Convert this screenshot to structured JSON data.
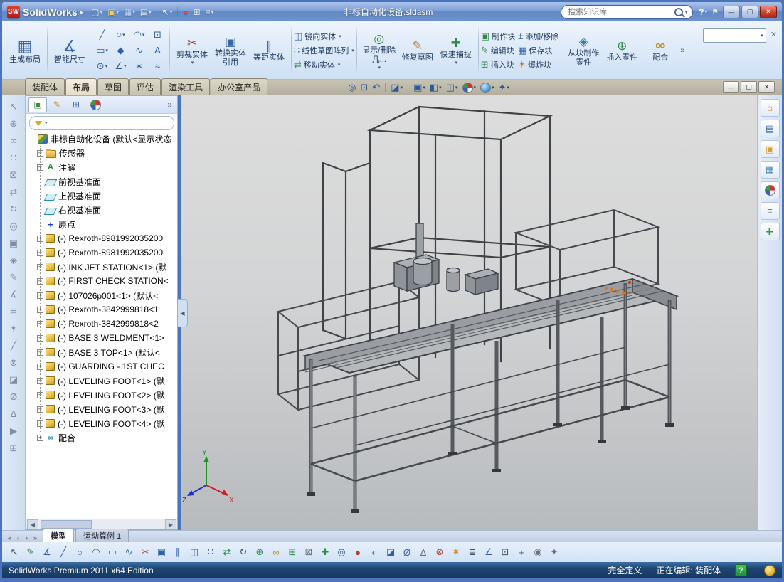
{
  "ui": {
    "dropdown_glyph": "▾",
    "overflow_glyph": "»"
  },
  "titlebar": {
    "app_name": "SolidWorks",
    "logo_text": "SW",
    "menu_arrow": "▸",
    "doc_title": "非标自动化设备.sldasm",
    "search_placeholder": "搜索知识库",
    "help_glyph": "?",
    "pin_glyph": "⚑",
    "qat": [
      {
        "name": "new-document",
        "g": "▢",
        "c": "#f0f4fc",
        "arrow": true
      },
      {
        "name": "open-document",
        "g": "▣",
        "c": "#f0cc6a",
        "arrow": true
      },
      {
        "name": "save-document",
        "g": "▦",
        "c": "#bcd2f2",
        "arrow": true
      },
      {
        "name": "print-document",
        "g": "▤",
        "c": "#e0e8f2",
        "arrow": true
      },
      {
        "sep": true
      },
      {
        "name": "select-cursor",
        "g": "↖",
        "c": "#ffffff",
        "arrow": true
      },
      {
        "sep": true
      },
      {
        "name": "rebuild",
        "g": "●",
        "c": "#e04838"
      },
      {
        "name": "file-properties",
        "g": "⊞",
        "c": "#dfe7f2"
      },
      {
        "name": "options",
        "g": "≡",
        "c": "#f0f4fc",
        "arrow": true
      }
    ],
    "window_controls": [
      {
        "name": "window-minimize",
        "g": "—"
      },
      {
        "name": "window-maximize",
        "g": "▢"
      },
      {
        "name": "window-close",
        "g": "✕"
      }
    ]
  },
  "ribbon": {
    "groups": {
      "layout": {
        "label": "生成布局",
        "glyph": "▦"
      },
      "smart_dimension": {
        "label": "智能尺寸",
        "glyph": "∡"
      },
      "trim": {
        "label": "剪裁实体",
        "glyph": "✂"
      },
      "convert": {
        "label": "转换实体引用",
        "glyph": "▣"
      },
      "offset": {
        "label": "等距实体",
        "glyph": "∥"
      },
      "mirror": {
        "label": "镜向实体",
        "glyph": "◫"
      },
      "linear_pattern": {
        "label": "线性草图阵列",
        "glyph": "∷"
      },
      "move": {
        "label": "移动实体",
        "glyph": "⇄"
      },
      "display_delete": {
        "label": "显示/删除几...",
        "glyph": "◎"
      },
      "repair": {
        "label": "修复草图",
        "glyph": "✎"
      },
      "quick_snap": {
        "label": "快速捕捉",
        "glyph": "✚"
      },
      "make_block": {
        "label": "制作块",
        "glyph": "▣"
      },
      "edit_block": {
        "label": "编辑块",
        "glyph": "✎"
      },
      "insert_block": {
        "label": "插入块",
        "glyph": "⊞"
      },
      "add_remove": {
        "label": "添加/移除",
        "glyph": "±"
      },
      "save_block": {
        "label": "保存块",
        "glyph": "▦"
      },
      "explode_block": {
        "label": "爆炸块",
        "glyph": "✶"
      },
      "part_from_block": {
        "label": "从块制作零件",
        "glyph": "◈"
      },
      "insert_part": {
        "label": "插入零件",
        "glyph": "⊕"
      },
      "mate": {
        "label": "配合",
        "glyph": "∞"
      }
    },
    "sketch_tools": [
      {
        "name": "sketch-line",
        "g": "╱"
      },
      {
        "name": "sketch-circle",
        "g": "○",
        "arrow": true
      },
      {
        "name": "sketch-arc",
        "g": "◠",
        "arrow": true
      },
      {
        "name": "sketch-select-box",
        "g": "⊡"
      },
      {
        "name": "sketch-rectangle",
        "g": "▭",
        "arrow": true
      },
      {
        "name": "sketch-polygon",
        "g": "◆"
      },
      {
        "name": "sketch-spline",
        "g": "∿"
      },
      {
        "name": "sketch-text",
        "g": "A"
      },
      {
        "name": "sketch-ellipse",
        "g": "⊙",
        "arrow": true
      },
      {
        "name": "sketch-fillet",
        "g": "∠",
        "arrow": true
      },
      {
        "name": "sketch-point",
        "g": "∗"
      },
      {
        "name": "sketch-construction",
        "g": "≈"
      }
    ]
  },
  "tabrow": {
    "tabs": [
      {
        "label": "装配体"
      },
      {
        "label": "布局"
      },
      {
        "label": "草图"
      },
      {
        "label": "评估"
      },
      {
        "label": "渲染工具"
      },
      {
        "label": "办公室产品"
      }
    ],
    "active_tab": "布局",
    "doc_controls": [
      {
        "name": "document-minimize",
        "g": "—"
      },
      {
        "name": "document-restore",
        "g": "▢"
      },
      {
        "name": "document-close",
        "g": "✕"
      }
    ]
  },
  "headsup": {
    "icons": [
      {
        "name": "zoom-fit",
        "g": "◎",
        "c": "#2a5a9a"
      },
      {
        "name": "zoom-area",
        "g": "⊡",
        "c": "#2a5a9a"
      },
      {
        "name": "previous-view",
        "g": "↶",
        "c": "#2a5a9a"
      },
      {
        "sep": true
      },
      {
        "name": "section-view",
        "g": "◪",
        "c": "#2a5a9a",
        "arrow": true
      },
      {
        "sep": true
      },
      {
        "name": "view-orientation",
        "g": "▣",
        "c": "#2a5a9a",
        "arrow": true
      },
      {
        "name": "display-style",
        "g": "◧",
        "c": "#2a5a9a",
        "arrow": true
      },
      {
        "name": "hide-show-items",
        "g": "◫",
        "c": "#2a5a9a",
        "arrow": true
      },
      {
        "name": "edit-appearance",
        "ball": "ball-app",
        "arrow": true
      },
      {
        "name": "apply-scene",
        "ball": "ball-scene",
        "arrow": true
      },
      {
        "name": "view-settings",
        "g": "✦",
        "c": "#2a5a9a",
        "arrow": true
      }
    ]
  },
  "feature_tree": {
    "header_tabs": [
      {
        "name": "featuremanager-tab",
        "g": "▣",
        "c": "#3a8a3a"
      },
      {
        "name": "propertymanager-tab",
        "g": "✎",
        "c": "#c09020"
      },
      {
        "name": "configurationmanager-tab",
        "g": "⊞",
        "c": "#3a6ab0"
      },
      {
        "name": "displaymanager-tab",
        "ball": "ball-app"
      }
    ],
    "flyout_glyph": "»",
    "items": [
      {
        "id": "root",
        "icon": "assembly",
        "label": "非标自动化设备 (默认<显示状态",
        "root": true
      },
      {
        "id": "sensors-folder",
        "icon": "folder",
        "label": "传感器",
        "exp": "+"
      },
      {
        "id": "annotations",
        "icon": "annotation",
        "label": "注解",
        "exp": "+"
      },
      {
        "id": "front-plane",
        "icon": "plane",
        "label": "前视基准面"
      },
      {
        "id": "top-plane",
        "icon": "plane",
        "label": "上视基准面"
      },
      {
        "id": "right-plane",
        "icon": "plane",
        "label": "右视基准面"
      },
      {
        "id": "origin",
        "icon": "origin",
        "label": "原点"
      },
      {
        "id": "comp-rexroth-1",
        "icon": "part",
        "label": "(-) Rexroth-8981992035200",
        "exp": "+"
      },
      {
        "id": "comp-rexroth-2",
        "icon": "part",
        "label": "(-) Rexroth-8981992035200",
        "exp": "+"
      },
      {
        "id": "comp-inkjet",
        "icon": "part",
        "label": "(-) INK JET STATION<1> (默",
        "exp": "+"
      },
      {
        "id": "comp-firstcheck",
        "icon": "part",
        "label": "(-) FIRST CHECK STATION<",
        "exp": "+"
      },
      {
        "id": "comp-107026p001",
        "icon": "part",
        "label": "(-) 107026p001<1> (默认<",
        "exp": "+"
      },
      {
        "id": "comp-rexroth-3842-1",
        "icon": "part",
        "label": "(-) Rexroth-3842999818<1",
        "exp": "+"
      },
      {
        "id": "comp-rexroth-3842-2",
        "icon": "part",
        "label": "(-) Rexroth-3842999818<2",
        "exp": "+"
      },
      {
        "id": "comp-base3-weldment",
        "icon": "part",
        "label": "(-) BASE 3 WELDMENT<1>",
        "exp": "+"
      },
      {
        "id": "comp-base3-top",
        "icon": "part",
        "label": "(-) BASE 3 TOP<1> (默认<",
        "exp": "+"
      },
      {
        "id": "comp-guarding",
        "icon": "part",
        "label": "(-) GUARDING - 1ST CHEC",
        "exp": "+"
      },
      {
        "id": "comp-leveling-foot-1",
        "icon": "part",
        "label": "(-) LEVELING FOOT<1> (默",
        "exp": "+"
      },
      {
        "id": "comp-leveling-foot-2",
        "icon": "part",
        "label": "(-) LEVELING FOOT<2> (默",
        "exp": "+"
      },
      {
        "id": "comp-leveling-foot-3",
        "icon": "part",
        "label": "(-) LEVELING FOOT<3> (默",
        "exp": "+"
      },
      {
        "id": "comp-leveling-foot-4",
        "icon": "part",
        "label": "(-) LEVELING FOOT<4> (默",
        "exp": "+"
      },
      {
        "id": "mates",
        "icon": "mate",
        "label": "配合",
        "exp": "+"
      }
    ]
  },
  "leftbar": {
    "icons": [
      {
        "name": "select-tool",
        "g": "↖",
        "c": "#7d8da3"
      },
      {
        "name": "insert-components",
        "g": "⊕",
        "c": "#7d8da3"
      },
      {
        "name": "mate-tool",
        "g": "∞",
        "c": "#7d8da3"
      },
      {
        "name": "component-pattern",
        "g": "∷",
        "c": "#7d8da3"
      },
      {
        "name": "smart-fasteners",
        "g": "⊠",
        "c": "#7d8da3"
      },
      {
        "name": "move-component",
        "g": "⇄",
        "c": "#7d8da3"
      },
      {
        "name": "rotate-component",
        "g": "↻",
        "c": "#7d8da3"
      },
      {
        "name": "show-hidden-components",
        "g": "◎",
        "c": "#7d8da3"
      },
      {
        "name": "assembly-features",
        "g": "▣",
        "c": "#7d8da3"
      },
      {
        "name": "reference-geometry",
        "g": "◈",
        "c": "#7d8da3"
      },
      {
        "name": "sketch-tool",
        "g": "✎",
        "c": "#7d8da3"
      },
      {
        "name": "smart-dimension-tool",
        "g": "∡",
        "c": "#7d8da3"
      },
      {
        "name": "bill-of-materials",
        "g": "≣",
        "c": "#7d8da3"
      },
      {
        "name": "exploded-view",
        "g": "✶",
        "c": "#7d8da3"
      },
      {
        "name": "explode-line-sketch",
        "g": "╱",
        "c": "#7d8da3"
      },
      {
        "name": "interference-detection",
        "g": "⊗",
        "c": "#7d8da3"
      },
      {
        "name": "aligned-section-view",
        "g": "◪",
        "c": "#7d8da3"
      },
      {
        "name": "measure-tool",
        "g": "Ø",
        "c": "#7d8da3"
      },
      {
        "name": "mass-properties",
        "g": "Δ",
        "c": "#7d8da3"
      },
      {
        "name": "motion-study",
        "g": "▶",
        "c": "#7d8da3"
      },
      {
        "name": "toolbox",
        "g": "⊞",
        "c": "#7d8da3"
      }
    ]
  },
  "rightbar": {
    "icons": [
      {
        "name": "solidworks-resources",
        "g": "⌂",
        "c": "#c07820"
      },
      {
        "name": "design-library",
        "g": "▤",
        "c": "#3a6ab0"
      },
      {
        "name": "file-explorer",
        "g": "▣",
        "c": "#d8a030"
      },
      {
        "name": "view-palette",
        "g": "▦",
        "c": "#3a8ab0"
      },
      {
        "name": "appearances-scenes",
        "ball": "ball-app"
      },
      {
        "name": "custom-properties",
        "g": "≡",
        "c": "#666e78"
      },
      {
        "name": "document-recovery",
        "g": "✚",
        "c": "#3a9a4a"
      }
    ]
  },
  "viewport": {
    "triad": {
      "x_label": "X",
      "y_label": "Y",
      "z_label": "Z"
    }
  },
  "model_tabs": {
    "nav": [
      {
        "name": "rewind",
        "g": "«"
      },
      {
        "name": "previous",
        "g": "‹"
      },
      {
        "name": "next",
        "g": "›"
      },
      {
        "name": "forward",
        "g": "»"
      }
    ],
    "tabs": [
      {
        "label": "模型"
      },
      {
        "label": "运动算例 1"
      }
    ],
    "active": "模型"
  },
  "bottombar": {
    "icons": [
      {
        "name": "select",
        "g": "↖",
        "c": "#44506a"
      },
      {
        "name": "sketch",
        "g": "✎",
        "c": "#2e8a4a"
      },
      {
        "name": "smart-dimension",
        "g": "∡",
        "c": "#2f5fa8"
      },
      {
        "name": "line",
        "g": "╱",
        "c": "#2f5fa8"
      },
      {
        "name": "circle",
        "g": "○",
        "c": "#2f5fa8"
      },
      {
        "name": "arc",
        "g": "◠",
        "c": "#2f5fa8"
      },
      {
        "name": "rectangle",
        "g": "▭",
        "c": "#2f5fa8"
      },
      {
        "name": "spline",
        "g": "∿",
        "c": "#2f5fa8"
      },
      {
        "name": "trim-entities",
        "g": "✂",
        "c": "#b04030"
      },
      {
        "name": "convert-entities",
        "g": "▣",
        "c": "#2f5fa8"
      },
      {
        "name": "offset-entities",
        "g": "∥",
        "c": "#2f5fa8"
      },
      {
        "name": "mirror-entities",
        "g": "◫",
        "c": "#2f5fa8"
      },
      {
        "name": "linear-sketch-pattern",
        "g": "∷",
        "c": "#2f5fa8"
      },
      {
        "name": "move-entities",
        "g": "⇄",
        "c": "#2e8a4a"
      },
      {
        "name": "rotate-view",
        "g": "↻",
        "c": "#44506a"
      },
      {
        "name": "insert-components",
        "g": "⊕",
        "c": "#2e8a4a"
      },
      {
        "name": "mate",
        "g": "∞",
        "c": "#c09020"
      },
      {
        "name": "component-pattern",
        "g": "⊞",
        "c": "#2e8a4a"
      },
      {
        "name": "smart-fasteners",
        "g": "⊠",
        "c": "#6a7280"
      },
      {
        "name": "move-component",
        "g": "✚",
        "c": "#2e8a4a"
      },
      {
        "name": "hide-show",
        "g": "◎",
        "c": "#2f5fa8"
      },
      {
        "name": "edit-appearance",
        "g": "●",
        "c": "#b04030"
      },
      {
        "name": "apply-scene",
        "g": "◐",
        "c": "#3a8ab0"
      },
      {
        "name": "section-view",
        "g": "◪",
        "c": "#2f5fa8"
      },
      {
        "name": "measure",
        "g": "Ø",
        "c": "#2f5fa8"
      },
      {
        "name": "mass-properties",
        "g": "Δ",
        "c": "#6a7280"
      },
      {
        "name": "interference-detection",
        "g": "⊗",
        "c": "#b04030"
      },
      {
        "name": "exploded-view",
        "g": "✶",
        "c": "#d07820"
      },
      {
        "name": "bill-of-materials",
        "g": "≣",
        "c": "#44506a"
      },
      {
        "name": "sketch-fillet",
        "g": "∠",
        "c": "#2f5fa8"
      },
      {
        "name": "zoom-to-fit",
        "g": "⊡",
        "c": "#44506a"
      },
      {
        "name": "origin-visibility",
        "g": "+",
        "c": "#2f5fa8"
      },
      {
        "name": "camera-views",
        "g": "◉",
        "c": "#6a7280"
      },
      {
        "name": "options-settings",
        "g": "✦",
        "c": "#6a7280"
      }
    ]
  },
  "statusbar": {
    "edition": "SolidWorks Premium 2011 x64 Edition",
    "defined_status": "完全定义",
    "editing_status": "正在编辑: 装配体",
    "help_glyph": "?"
  }
}
